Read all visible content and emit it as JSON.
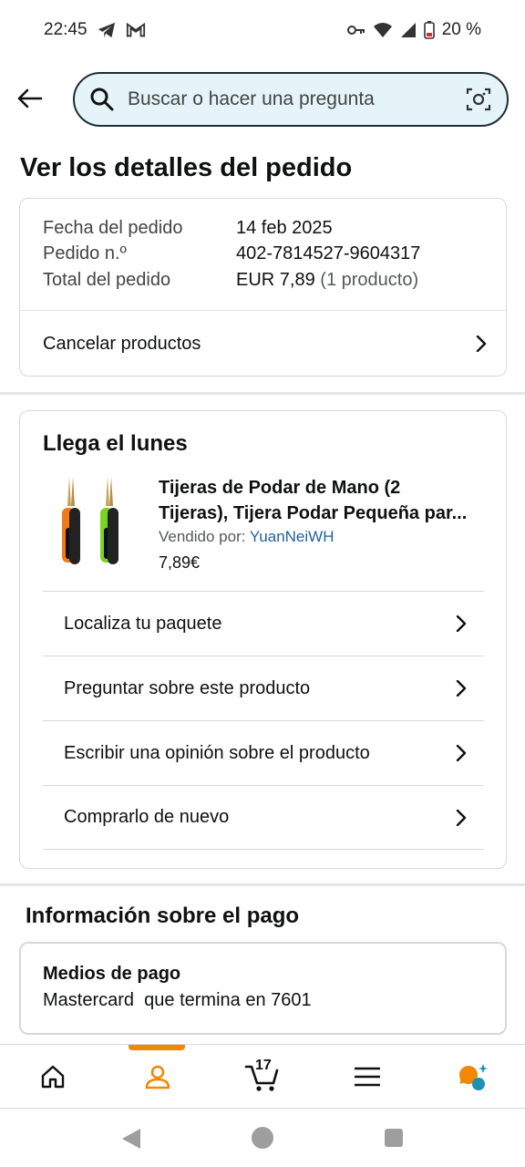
{
  "status_bar": {
    "time": "22:45",
    "battery": "20 %"
  },
  "search": {
    "placeholder": "Buscar o hacer una pregunta"
  },
  "page": {
    "title": "Ver los detalles del pedido"
  },
  "order_summary": {
    "rows": [
      {
        "label": "Fecha del pedido",
        "value": "14 feb 2025"
      },
      {
        "label": "Pedido n.º",
        "value": "402-7814527-9604317"
      },
      {
        "label": "Total del pedido",
        "value": "EUR 7,89",
        "extra": "(1 producto)"
      }
    ],
    "cancel_label": "Cancelar productos"
  },
  "delivery": {
    "title": "Llega el lunes",
    "product": {
      "name_line1": "Tijeras de Podar de Mano (2",
      "name_line2": "Tijeras), Tijera Podar Pequeña par...",
      "sold_by_label": "Vendido por:",
      "seller": "YuanNeiWH",
      "price": "7,89€"
    },
    "actions": [
      {
        "label": "Localiza tu paquete"
      },
      {
        "label": "Preguntar sobre este producto"
      },
      {
        "label": "Escribir una opinión sobre el producto"
      },
      {
        "label": "Comprarlo de nuevo"
      }
    ]
  },
  "payment": {
    "title": "Información sobre el pago",
    "method_label": "Medios de pago",
    "method_value": "Mastercard  que termina en 7601"
  },
  "bottom_nav": {
    "cart_count": "17",
    "active_tab": "account"
  },
  "colors": {
    "accent": "#f08804",
    "link": "#2162a1",
    "search_bg": "#e4f4f8"
  }
}
